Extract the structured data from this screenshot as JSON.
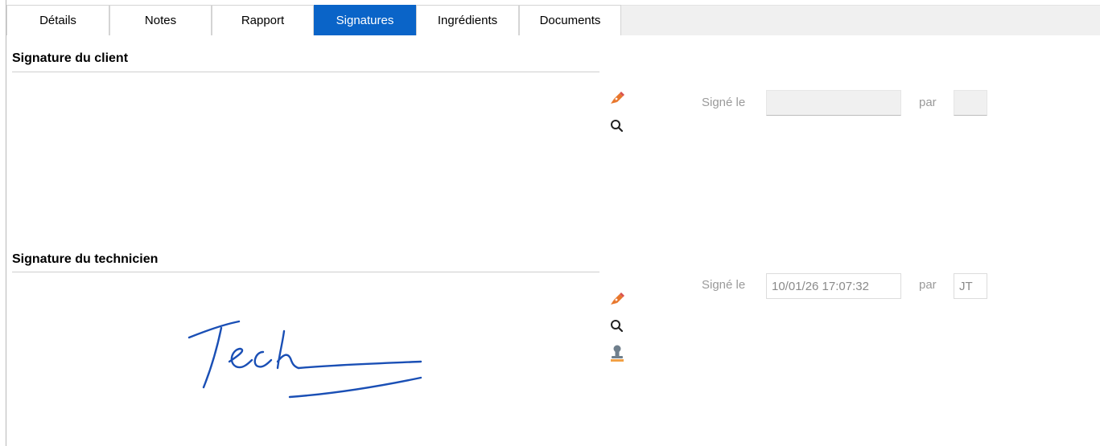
{
  "tabs": [
    {
      "label": "Détails",
      "active": false
    },
    {
      "label": "Notes",
      "active": false
    },
    {
      "label": "Rapport",
      "active": false
    },
    {
      "label": "Signatures",
      "active": true
    },
    {
      "label": "Ingrédients",
      "active": false
    },
    {
      "label": "Documents",
      "active": false
    }
  ],
  "client_signature": {
    "title": "Signature du client",
    "signed_label": "Signé le",
    "signed_value": "",
    "by_label": "par",
    "by_value": "",
    "icons": [
      "sign-pen-icon",
      "zoom-icon"
    ]
  },
  "tech_signature": {
    "title": "Signature du technicien",
    "signed_label": "Signé le",
    "signed_value": "10/01/26 17:07:32",
    "by_label": "par",
    "by_value": "JT",
    "signature_text": "Tech",
    "icons": [
      "sign-pen-icon",
      "zoom-icon",
      "stamp-icon"
    ]
  },
  "colors": {
    "accent": "#0a64c8",
    "pen_orange": "#e8762b",
    "signature_ink": "#1a4fb5"
  }
}
